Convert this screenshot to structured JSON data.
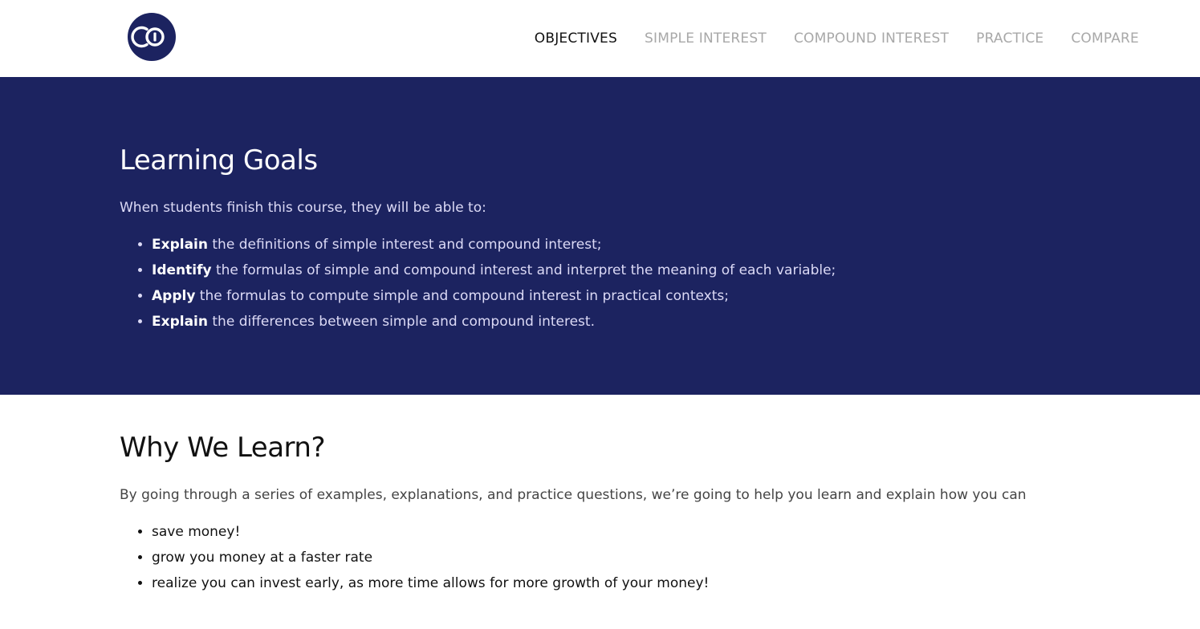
{
  "header": {
    "logo": {
      "icon": "coin-logo-icon",
      "color": "#1c2360"
    },
    "nav": [
      {
        "label": "OBJECTIVES",
        "active": true
      },
      {
        "label": "SIMPLE INTEREST",
        "active": false
      },
      {
        "label": "COMPOUND INTEREST",
        "active": false
      },
      {
        "label": "PRACTICE",
        "active": false
      },
      {
        "label": "COMPARE",
        "active": false
      }
    ]
  },
  "learning_goals": {
    "title": "Learning Goals",
    "intro": "When students finish this course, they will be able to:",
    "items": [
      {
        "verb": "Explain",
        "text": " the definitions of simple interest and compound interest;"
      },
      {
        "verb": "Identify",
        "text": " the formulas of simple and compound interest and interpret the meaning of each variable;"
      },
      {
        "verb": "Apply",
        "text": " the formulas to compute simple and compound interest in practical contexts;"
      },
      {
        "verb": "Explain",
        "text": " the differences between simple and compound interest."
      }
    ]
  },
  "why_learn": {
    "title": "Why We Learn?",
    "intro": "By going through a series of examples, explanations, and practice questions, we’re going to help you learn and explain how you can",
    "items": [
      "save money!",
      "grow you money at a faster rate",
      "realize you can invest early, as more time allows for more growth of your money!"
    ]
  },
  "colors": {
    "hero_background": "#1c2360",
    "nav_active": "#111111",
    "nav_inactive": "#a8a8a8"
  }
}
